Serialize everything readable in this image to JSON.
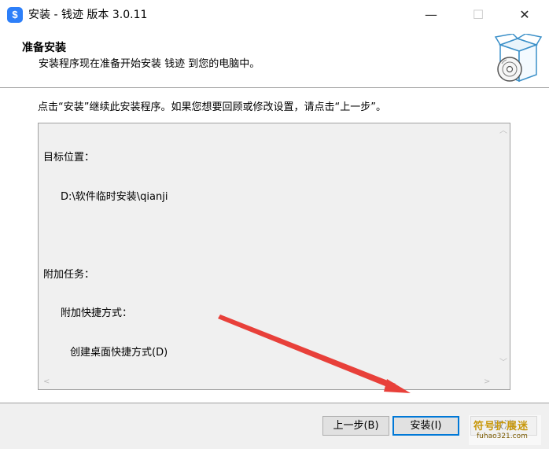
{
  "window": {
    "title": "安装 - 钱迹 版本 3.0.11",
    "app_icon_glyph": "$",
    "min_glyph": "—",
    "max_glyph": "☐",
    "close_glyph": "✕"
  },
  "header": {
    "title": "准备安装",
    "subtitle": "安装程序现在准备开始安装 钱迹 到您的电脑中。"
  },
  "content": {
    "instruction": "点击“安装”继续此安装程序。如果您想要回顾或修改设置，请点击“上一步”。",
    "memo": {
      "line1": "目标位置：",
      "line2": "D:\\软件临时安装\\qianji",
      "line3": "附加任务：",
      "line4": "附加快捷方式：",
      "line5": "创建桌面快捷方式(D)"
    }
  },
  "buttons": {
    "back_label": "上一步(B)",
    "install_label": "安装(I)",
    "cancel_label": "取消"
  },
  "watermark": {
    "main": "符号扩展迷",
    "sub": "fuhao321.com"
  },
  "colors": {
    "accent": "#0078d7",
    "annotation_arrow": "#e8403a",
    "app_icon": "#2d7ff9"
  }
}
